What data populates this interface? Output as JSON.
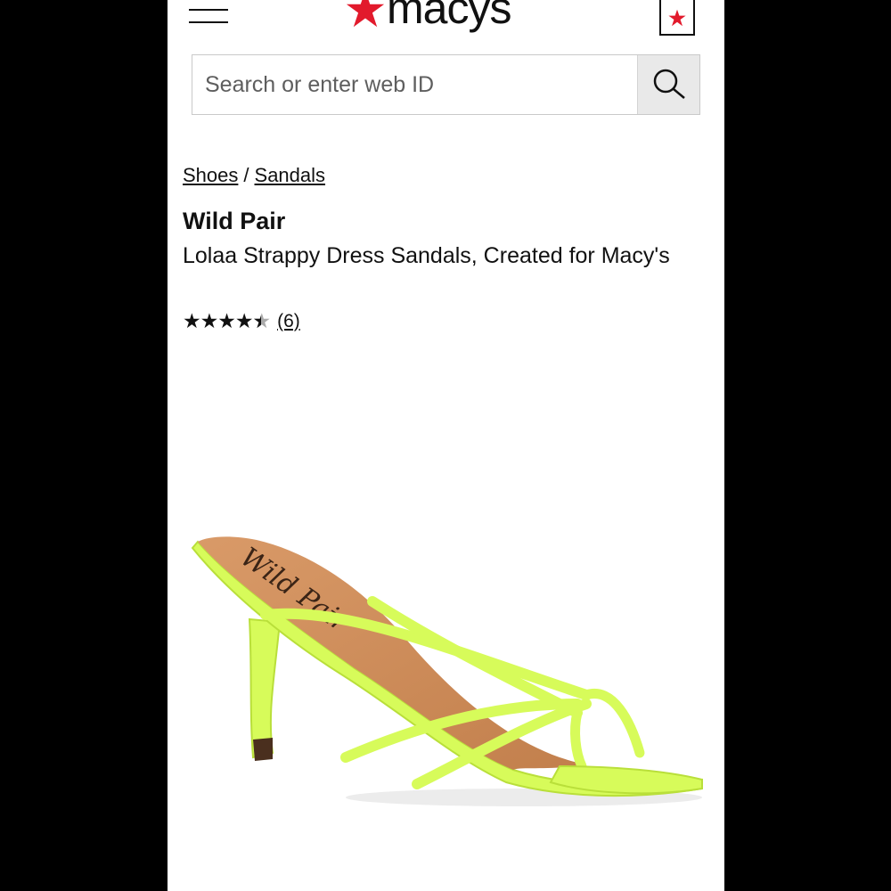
{
  "header": {
    "logo_text": "macys",
    "brand_color": "#e21a2c",
    "menu_icon": "hamburger-icon",
    "bag_icon": "star-bag-icon"
  },
  "search": {
    "placeholder": "Search or enter web ID",
    "value": "",
    "button_icon": "search-icon"
  },
  "breadcrumb": {
    "items": [
      "Shoes",
      "Sandals"
    ],
    "separator": "/"
  },
  "product": {
    "brand": "Wild Pair",
    "name": "Lolaa Strappy Dress Sandals, Created for Macy's",
    "rating": 4.5,
    "rating_max": 5,
    "review_count": "(6)",
    "image_alt": "neon green strappy thong heel sandal",
    "insole_script": "Wild Pair"
  }
}
